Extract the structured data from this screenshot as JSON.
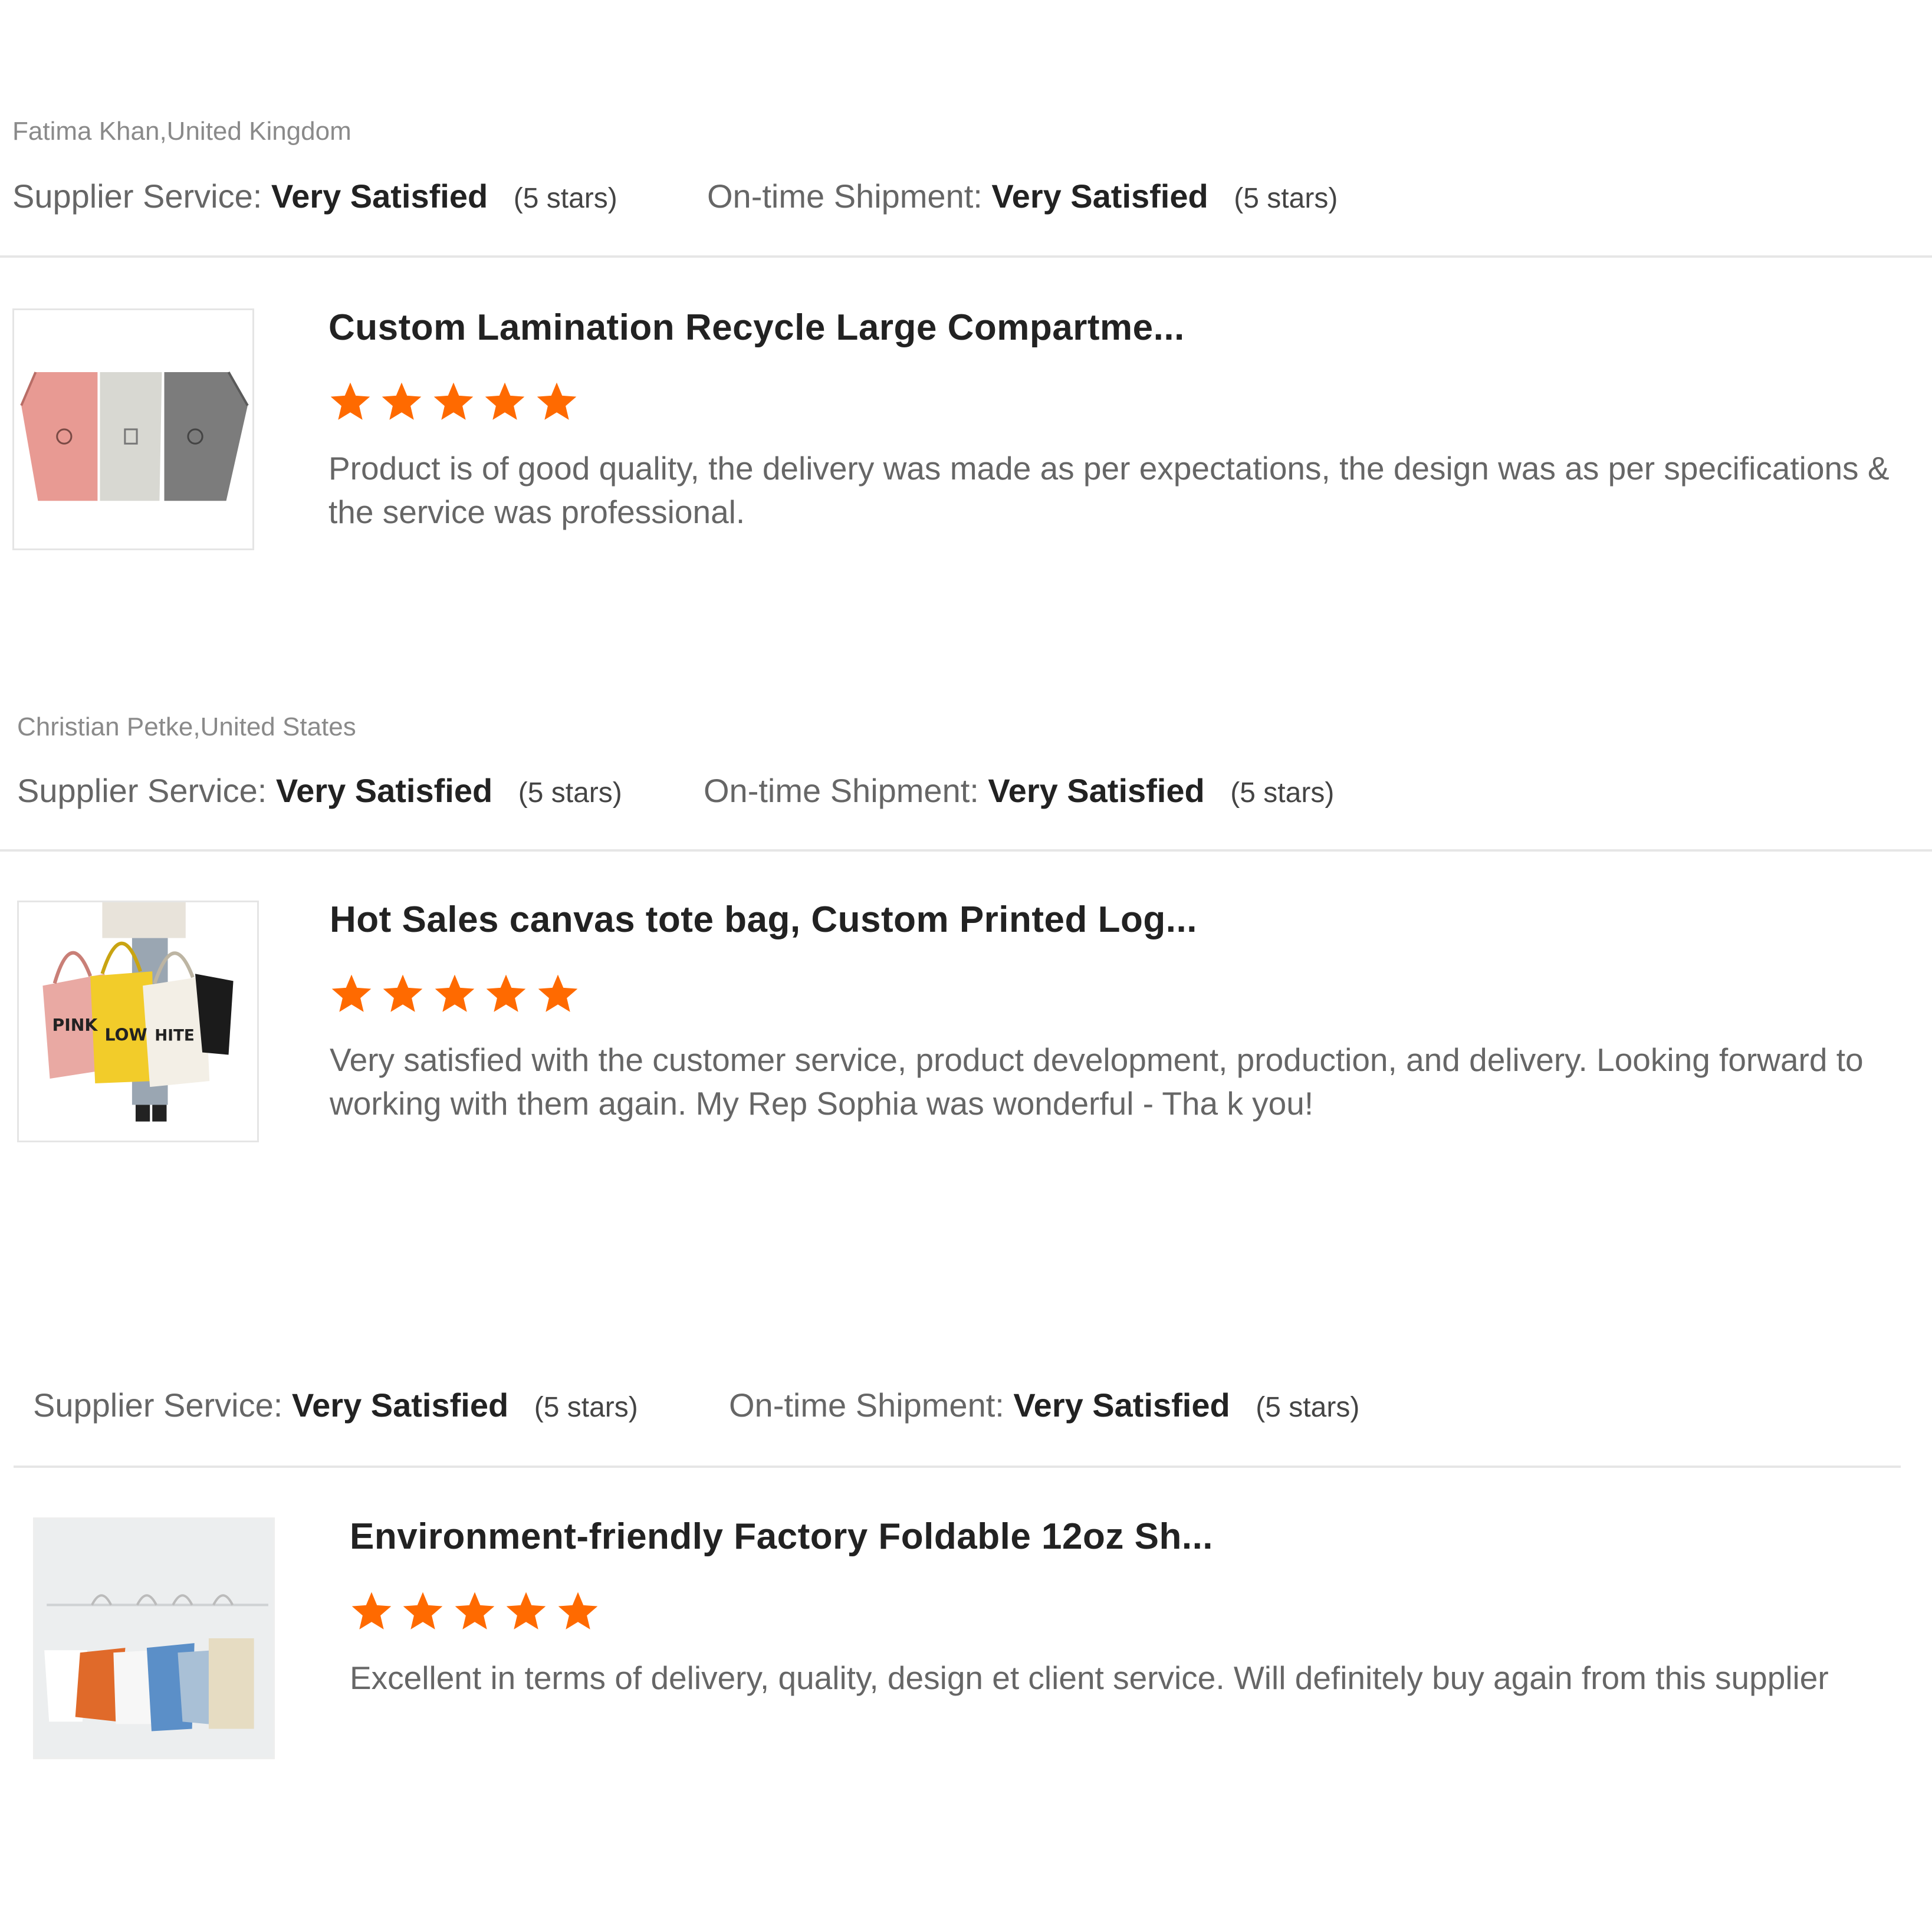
{
  "colors": {
    "star": "#ff6a00",
    "divider": "#e6e6e6",
    "muted_text": "#8a8a8a",
    "body_text": "#666666",
    "strong_text": "#222222"
  },
  "reviews": [
    {
      "reviewer": "Fatima Khan,United Kingdom",
      "supplier_service": {
        "label": "Supplier Service:",
        "value": "Very Satisfied",
        "stars": "(5 stars)"
      },
      "on_time_shipment": {
        "label": "On-time Shipment:",
        "value": "Very Satisfied",
        "stars": "(5 stars)"
      },
      "product_title": "Custom Lamination Recycle Large Compartme...",
      "product_image_icon": "recycle-bins-product-image",
      "rating": 5,
      "comment": "Product is of good quality, the delivery was made as per expectations, the design was as per specifications & the service was professional."
    },
    {
      "reviewer": "Christian Petke,United States",
      "supplier_service": {
        "label": "Supplier Service:",
        "value": "Very Satisfied",
        "stars": "(5 stars)"
      },
      "on_time_shipment": {
        "label": "On-time Shipment:",
        "value": "Very Satisfied",
        "stars": "(5 stars)"
      },
      "product_title": "Hot Sales canvas tote bag, Custom Printed Log...",
      "product_image_icon": "tote-bags-product-image",
      "product_image_text": [
        "PINK",
        "LOW",
        "HITE"
      ],
      "rating": 5,
      "comment": "Very satisfied with the customer service, product development, production, and delivery. Looking forward to working with them again. My Rep Sophia was wonderful - Tha k you!"
    },
    {
      "reviewer": "",
      "supplier_service": {
        "label": "Supplier Service:",
        "value": "Very Satisfied",
        "stars": "(5 stars)"
      },
      "on_time_shipment": {
        "label": "On-time Shipment:",
        "value": "Very Satisfied",
        "stars": "(5 stars)"
      },
      "product_title": "Environment-friendly Factory Foldable 12oz Sh...",
      "product_image_icon": "hanging-bags-product-image",
      "rating": 5,
      "comment": "Excellent in terms of delivery, quality, design et client service. Will definitely buy again from this supplier"
    }
  ]
}
